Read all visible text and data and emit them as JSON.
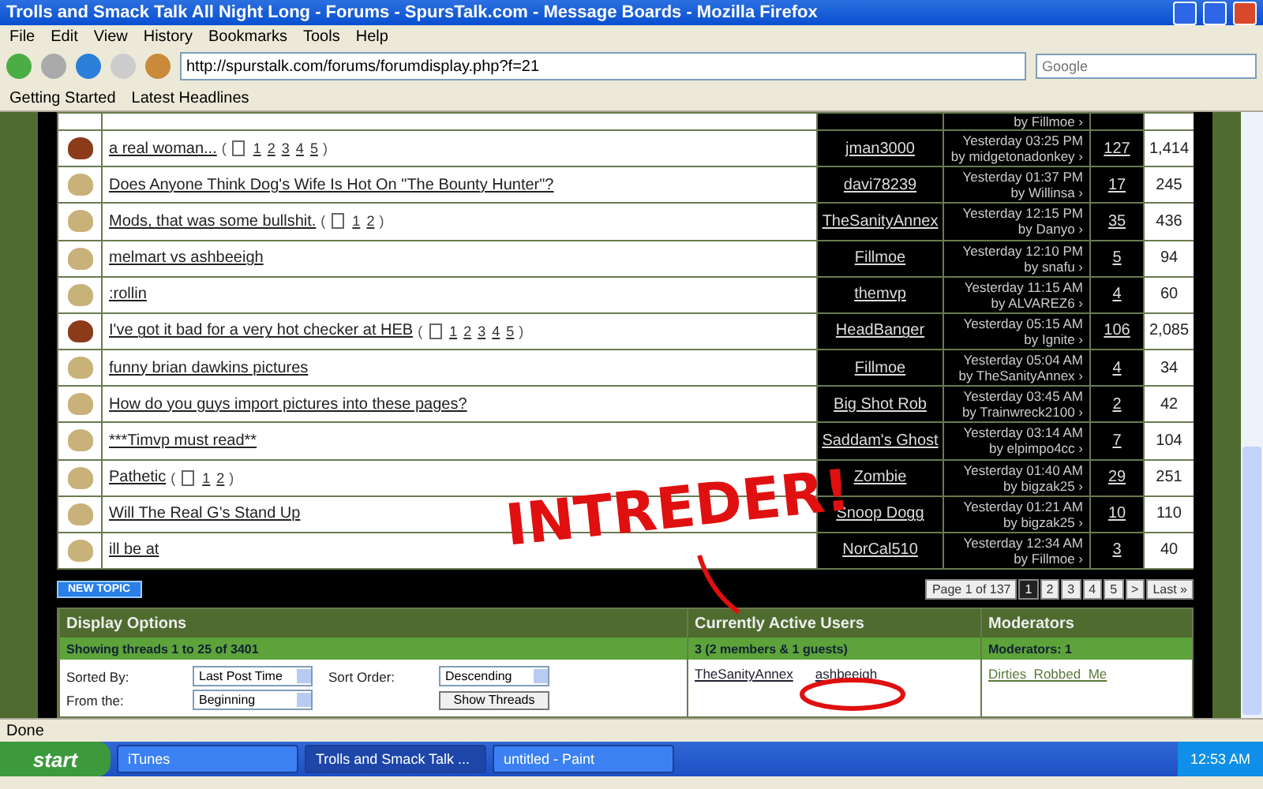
{
  "window": {
    "title": "Trolls and Smack Talk All Night Long - Forums - SpursTalk.com - Message Boards - Mozilla Firefox"
  },
  "menu": [
    "File",
    "Edit",
    "View",
    "History",
    "Bookmarks",
    "Tools",
    "Help"
  ],
  "address_bar": {
    "value": "http://spurstalk.com/forums/forumdisplay.php?f=21"
  },
  "search": {
    "placeholder": "Google"
  },
  "bookmarks": [
    "Getting Started",
    "Latest Headlines"
  ],
  "partial_row": {
    "last_by": "by Fillmoe ›"
  },
  "threads": [
    {
      "title": "a real woman...",
      "pages_open": "(",
      "pages": [
        "1",
        "2",
        "3",
        "4",
        "5"
      ],
      "pages_close": ")",
      "hot": true,
      "author": "jman3000",
      "last_time": "Yesterday 03:25 PM",
      "last_by": "by midgetonadonkey ›",
      "replies": "127",
      "views": "1,414"
    },
    {
      "title": "Does Anyone Think Dog's Wife Is Hot On \"The Bounty Hunter\"?",
      "hot": false,
      "author": "davi78239",
      "last_time": "Yesterday 01:37 PM",
      "last_by": "by Willinsa ›",
      "replies": "17",
      "views": "245"
    },
    {
      "title": "Mods, that was some bullshit.",
      "pages_open": "(",
      "pages": [
        "1",
        "2"
      ],
      "pages_close": ")",
      "hot": false,
      "author": "TheSanityAnnex",
      "last_time": "Yesterday 12:15 PM",
      "last_by": "by Danyo ›",
      "replies": "35",
      "views": "436"
    },
    {
      "title": "melmart vs ashbeeigh",
      "hot": false,
      "author": "Fillmoe",
      "last_time": "Yesterday 12:10 PM",
      "last_by": "by snafu ›",
      "replies": "5",
      "views": "94"
    },
    {
      "title": ":rollin",
      "hot": false,
      "author": "themvp",
      "last_time": "Yesterday 11:15 AM",
      "last_by": "by ALVAREZ6 ›",
      "replies": "4",
      "views": "60"
    },
    {
      "title": "I've got it bad for a very hot checker at HEB",
      "pages_open": "(",
      "pages": [
        "1",
        "2",
        "3",
        "4",
        "5"
      ],
      "pages_close": ")",
      "hot": true,
      "author": "HeadBanger",
      "last_time": "Yesterday 05:15 AM",
      "last_by": "by Ignite ›",
      "replies": "106",
      "views": "2,085"
    },
    {
      "title": "funny brian dawkins pictures",
      "hot": false,
      "author": "Fillmoe",
      "last_time": "Yesterday 05:04 AM",
      "last_by": "by TheSanityAnnex ›",
      "replies": "4",
      "views": "34"
    },
    {
      "title": "How do you guys import pictures into these pages?",
      "hot": false,
      "author": "Big Shot Rob",
      "last_time": "Yesterday 03:45 AM",
      "last_by": "by Trainwreck2100 ›",
      "replies": "2",
      "views": "42"
    },
    {
      "title": "***Timvp must read**",
      "hot": false,
      "author": "Saddam's Ghost",
      "last_time": "Yesterday 03:14 AM",
      "last_by": "by elpimpo4cc ›",
      "replies": "7",
      "views": "104"
    },
    {
      "title": "Pathetic",
      "pages_open": "(",
      "pages": [
        "1",
        "2"
      ],
      "pages_close": ")",
      "hot": false,
      "author": "Zombie",
      "last_time": "Yesterday 01:40 AM",
      "last_by": "by bigzak25 ›",
      "replies": "29",
      "views": "251"
    },
    {
      "title": "Will The Real G's Stand Up",
      "hot": false,
      "author": "Snoop Dogg",
      "last_time": "Yesterday 01:21 AM",
      "last_by": "by bigzak25 ›",
      "replies": "10",
      "views": "110"
    },
    {
      "title": "ill be at",
      "hot": false,
      "author": "NorCal510",
      "last_time": "Yesterday 12:34 AM",
      "last_by": "by Fillmoe ›",
      "replies": "3",
      "views": "40"
    }
  ],
  "new_topic_button": "NEW TOPIC",
  "pagination": {
    "label": "Page 1 of 137",
    "pages": [
      {
        "label": "1",
        "selected": true
      },
      {
        "label": "2",
        "selected": false
      },
      {
        "label": "3",
        "selected": false
      },
      {
        "label": "4",
        "selected": false
      },
      {
        "label": "5",
        "selected": false
      }
    ],
    "next": ">",
    "last": "Last »"
  },
  "display_options": {
    "title": "Display Options",
    "subtitle": "Showing threads 1 to 25 of 3401",
    "sorted_by_label": "Sorted By:",
    "sorted_by": "Last Post Time",
    "from_label": "From the:",
    "from": "Beginning",
    "order_label": "Sort Order:",
    "order": "Descending",
    "button": "Show Threads"
  },
  "active_users": {
    "title": "Currently Active Users",
    "subtitle": "3 (2 members & 1 guests)",
    "members": [
      "TheSanityAnnex",
      "ashbeeigh"
    ]
  },
  "moderators": {
    "title": "Moderators",
    "subtitle": "Moderators: 1",
    "members": [
      "Dirties_Robbed_Me"
    ]
  },
  "annotation": "INTREDER!",
  "status_bar": "Done",
  "taskbar": {
    "start": "start",
    "tasks": [
      {
        "label": "iTunes",
        "selected": false
      },
      {
        "label": "Trolls and Smack Talk ...",
        "selected": true
      },
      {
        "label": "untitled - Paint",
        "selected": false
      }
    ],
    "clock": "12:53 AM"
  }
}
